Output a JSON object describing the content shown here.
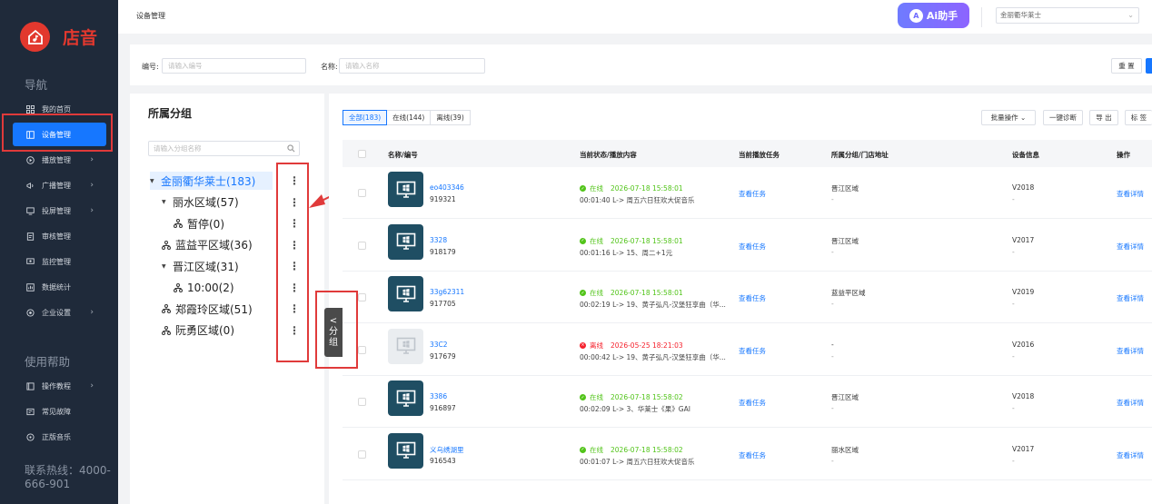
{
  "brand": {
    "name": "店音",
    "accent": "#e2382e"
  },
  "sidebar": {
    "nav_title": "导航",
    "items": [
      {
        "label": "我的首页",
        "icon": "grid-icon",
        "arrow": false,
        "active": false
      },
      {
        "label": "设备管理",
        "icon": "device-icon",
        "arrow": false,
        "active": true
      },
      {
        "label": "播放管理",
        "icon": "play-icon",
        "arrow": true,
        "active": false
      },
      {
        "label": "广播管理",
        "icon": "broadcast-icon",
        "arrow": true,
        "active": false
      },
      {
        "label": "投屏管理",
        "icon": "screen-cast-icon",
        "arrow": true,
        "active": false
      },
      {
        "label": "审核管理",
        "icon": "audit-icon",
        "arrow": false,
        "active": false
      },
      {
        "label": "监控管理",
        "icon": "monitor-icon",
        "arrow": false,
        "active": false
      },
      {
        "label": "数据统计",
        "icon": "stats-icon",
        "arrow": false,
        "active": false
      },
      {
        "label": "企业设置",
        "icon": "settings-icon",
        "arrow": true,
        "active": false
      }
    ],
    "help_title": "使用帮助",
    "help_items": [
      {
        "label": "操作教程",
        "icon": "tutorial-icon",
        "arrow": true
      },
      {
        "label": "常见故障",
        "icon": "faq-icon",
        "arrow": false
      },
      {
        "label": "正版音乐",
        "icon": "music-icon",
        "arrow": false
      }
    ],
    "hotline": "联系热线：4000-666-901",
    "arrow_glyph": "›"
  },
  "header": {
    "breadcrumb": "设备管理",
    "ai_label": "Ai助手",
    "ai_glyph": "A",
    "store": "金丽衢华莱士",
    "chevron": "⌄"
  },
  "filter": {
    "code_label": "编号:",
    "code_placeholder": "请输入编号",
    "name_label": "名称:",
    "name_placeholder": "请输入名称",
    "reset": "重 置"
  },
  "tree": {
    "title": "所属分组",
    "search_placeholder": "请输入分组名称",
    "caret": "▼",
    "kebab": "⋮",
    "nodes": [
      {
        "label": "金丽衢华莱士(183)",
        "caret": true,
        "icon": false,
        "selected": true
      },
      {
        "label": "丽水区域(57)",
        "caret": true,
        "icon": false,
        "selected": false
      },
      {
        "label": "暂停(0)",
        "caret": false,
        "icon": true,
        "selected": false
      },
      {
        "label": "蓝益平区域(36)",
        "caret": false,
        "icon": true,
        "selected": false
      },
      {
        "label": "晋江区域(31)",
        "caret": true,
        "icon": false,
        "selected": false
      },
      {
        "label": "10:00(2)",
        "caret": false,
        "icon": true,
        "selected": false
      },
      {
        "label": "郑霞玲区域(51)",
        "caret": false,
        "icon": true,
        "selected": false
      },
      {
        "label": "阮勇区域(0)",
        "caret": false,
        "icon": true,
        "selected": false
      }
    ],
    "collapse_chevron": "<",
    "collapse_label_1": "分",
    "collapse_label_2": "组"
  },
  "main": {
    "tabs": [
      "全部(183)",
      "在线(144)",
      "离线(39)"
    ],
    "actions": {
      "batch": "批量操作",
      "diagnose": "一键诊断",
      "export": "导 出",
      "tag": "标 签"
    },
    "columns": [
      "名称/编号",
      "当前状态/播放内容",
      "当前播放任务",
      "所属分组/门店地址",
      "设备信息",
      "操作"
    ],
    "rows": [
      {
        "code": "eo403346",
        "number": "919321",
        "online": true,
        "status": "在线",
        "time": "2026-07-18 15:58:01",
        "playing": "00:01:40 L-> 周五六日狂欢大促音乐",
        "task": "查看任务",
        "region": "晋江区域",
        "region_sub": "-",
        "version": "V2018",
        "version_sub": "-",
        "action": "查看详情"
      },
      {
        "code": "3328",
        "number": "918179",
        "online": true,
        "status": "在线",
        "time": "2026-07-18 15:58:01",
        "playing": "00:01:16 L-> 15、周二+1元",
        "task": "查看任务",
        "region": "晋江区域",
        "region_sub": "-",
        "version": "V2017",
        "version_sub": "-",
        "action": "查看详情"
      },
      {
        "code": "33g62311",
        "number": "917705",
        "online": true,
        "status": "在线",
        "time": "2026-07-18 15:58:01",
        "playing": "00:02:19 L-> 19、黄子弘凡-汉堡狂享曲（华...",
        "task": "查看任务",
        "region": "蓝益平区域",
        "region_sub": "-",
        "version": "V2019",
        "version_sub": "-",
        "action": "查看详情"
      },
      {
        "code": "33C2",
        "number": "917679",
        "online": false,
        "status": "离线",
        "time": "2026-05-25 18:21:03",
        "playing": "00:00:42 L-> 19、黄子弘凡-汉堡狂享曲（华...",
        "task": "查看任务",
        "region": "-",
        "region_sub": "-",
        "version": "V2016",
        "version_sub": "-",
        "action": "查看详情"
      },
      {
        "code": "3386",
        "number": "916897",
        "online": true,
        "status": "在线",
        "time": "2026-07-18 15:58:02",
        "playing": "00:02:09 L-> 3、华莱士《果》GAI",
        "task": "查看任务",
        "region": "晋江区域",
        "region_sub": "-",
        "version": "V2018",
        "version_sub": "-",
        "action": "查看详情"
      },
      {
        "code": "义乌绣湖里",
        "number": "916543",
        "online": true,
        "status": "在线",
        "time": "2026-07-18 15:58:02",
        "playing": "00:01:07 L-> 周五六日狂欢大促音乐",
        "task": "查看任务",
        "region": "丽水区域",
        "region_sub": "-",
        "version": "V2017",
        "version_sub": "-",
        "action": "查看详情"
      }
    ]
  },
  "colors": {
    "primary": "#1677ff",
    "online": "#52c41a",
    "offline": "#f5222d",
    "sidebar_bg": "#1f2a3a",
    "annotation": "#e03a3a"
  }
}
